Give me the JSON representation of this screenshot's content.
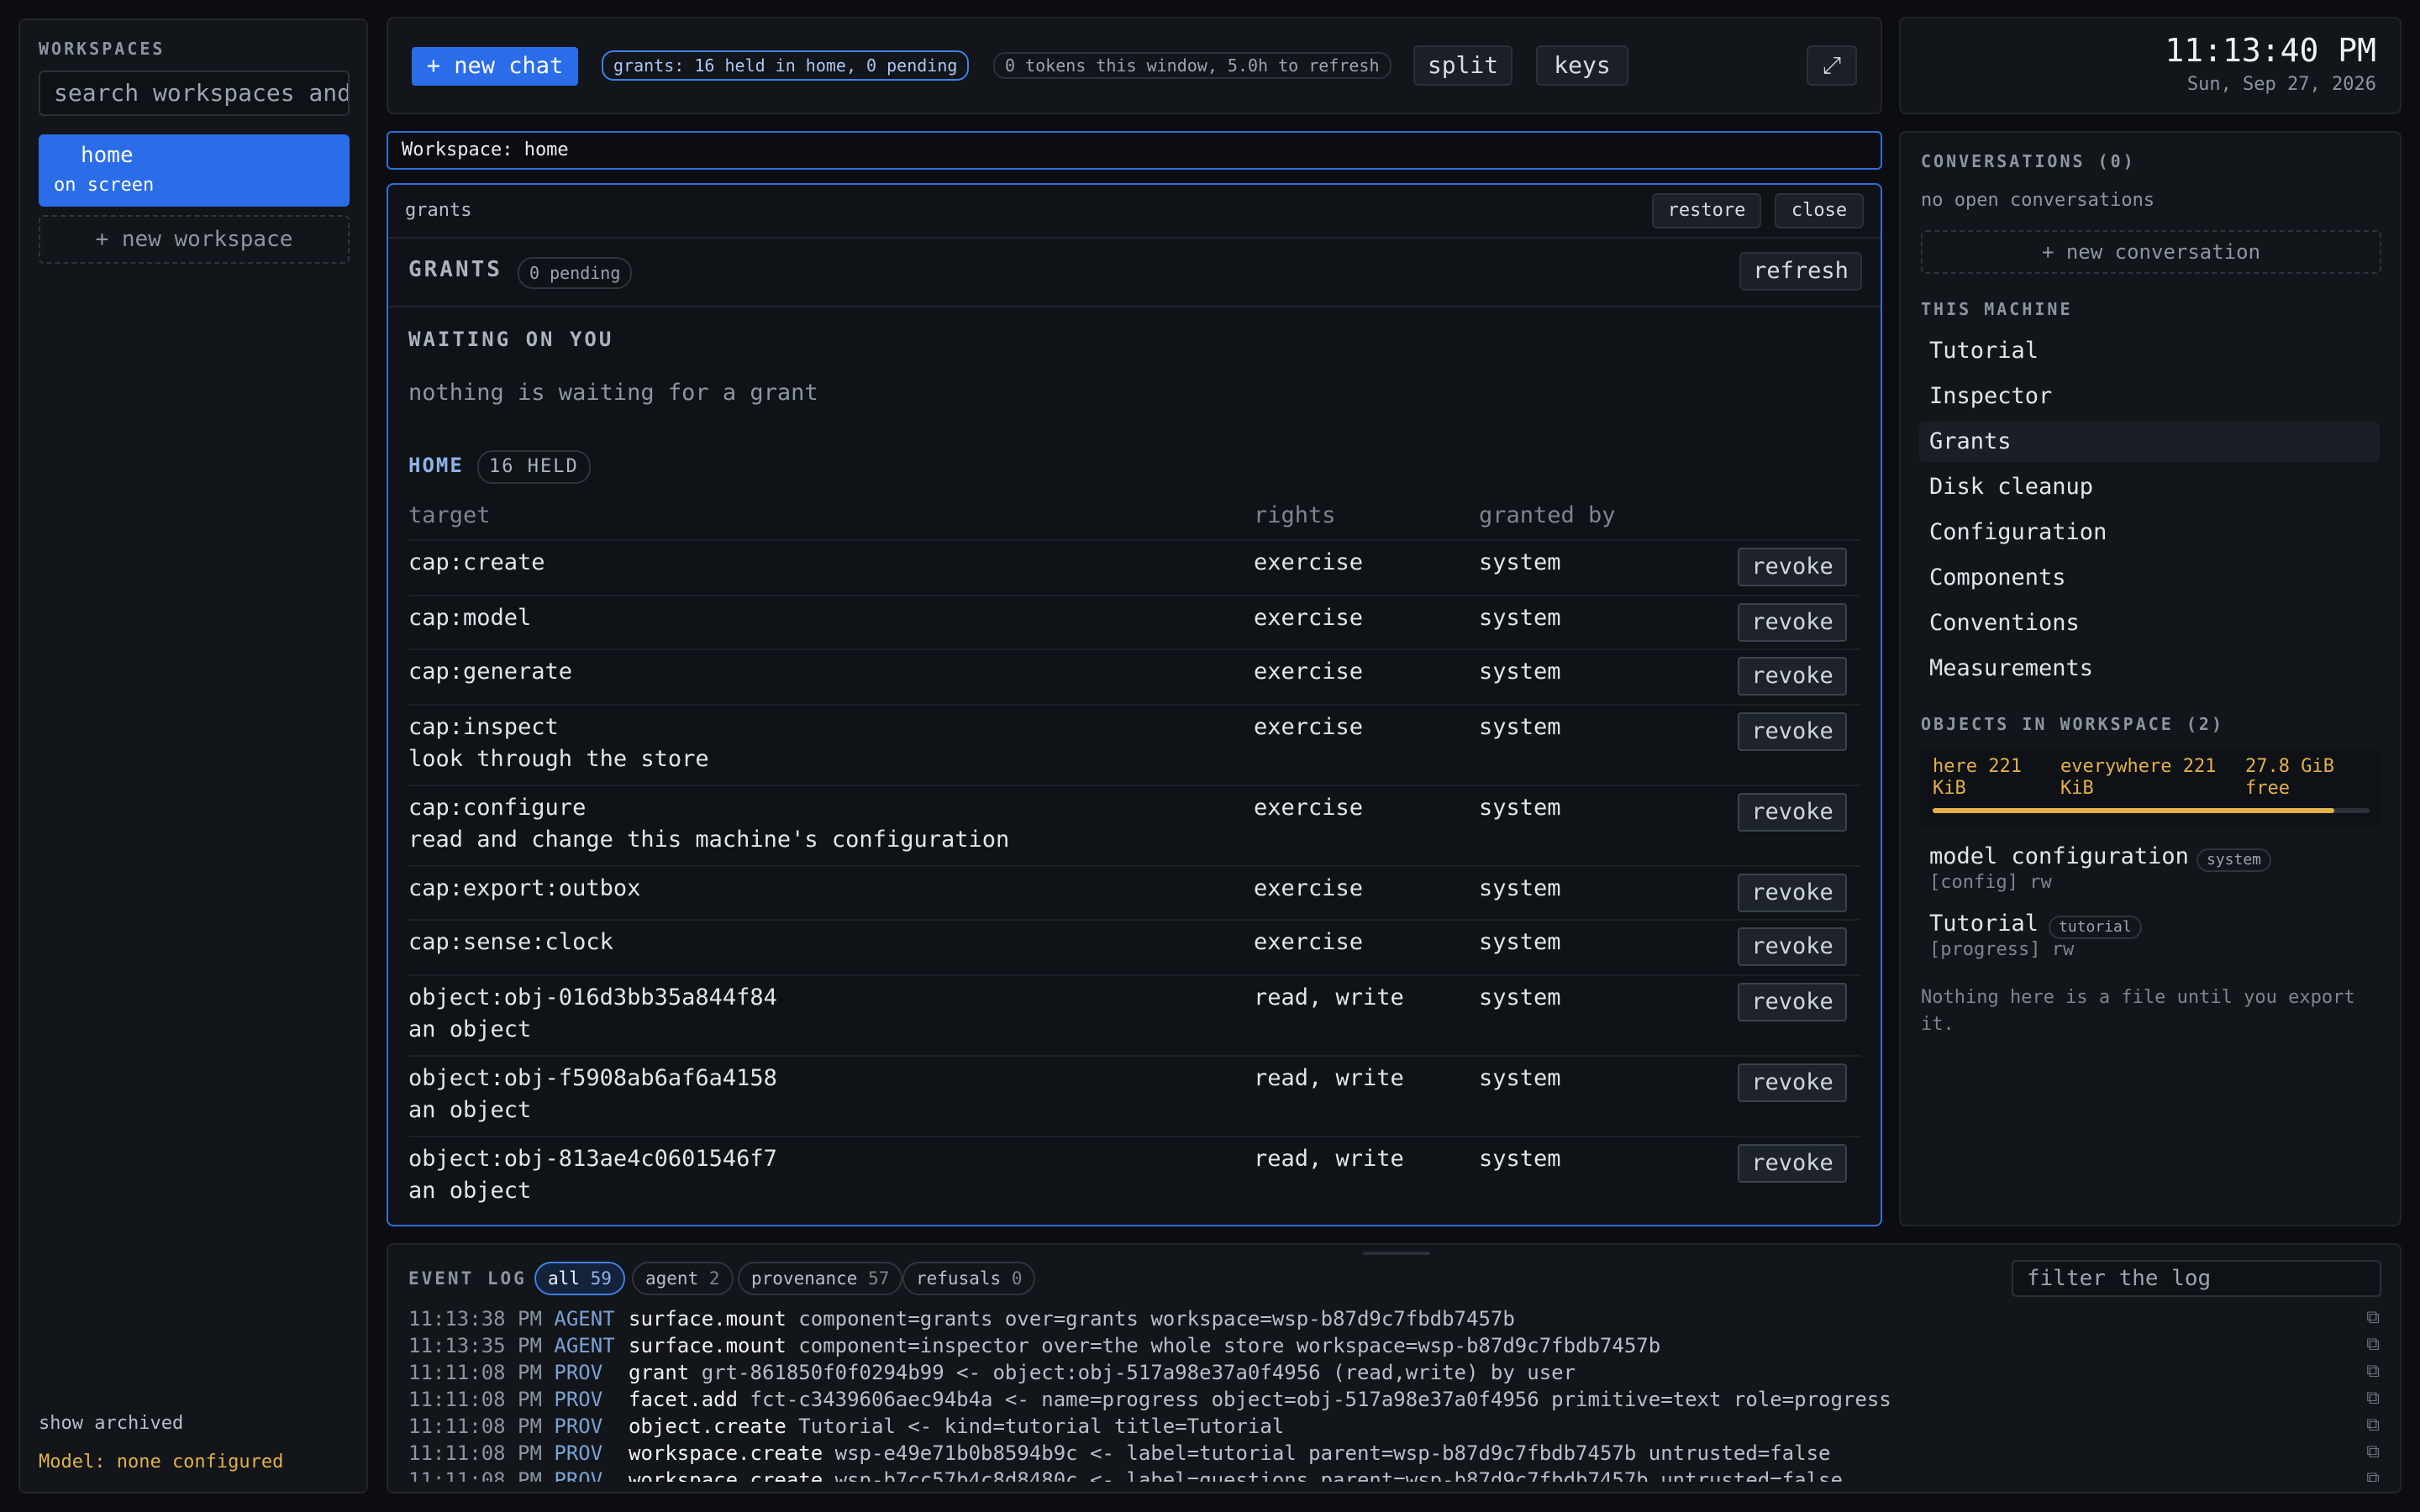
{
  "sidebar": {
    "title": "WORKSPACES",
    "search_placeholder": "search workspaces and",
    "workspaces": [
      {
        "label": "home",
        "status": "on screen"
      }
    ],
    "new_workspace": "+ new workspace",
    "show_archived": "show archived",
    "model_status": "Model: none configured"
  },
  "topbar": {
    "new_chat": "+ new chat",
    "grants_chip": "grants: 16 held in home, 0 pending",
    "tokens_chip": "0 tokens this window, 5.0h to refresh",
    "split": "split",
    "keys": "keys",
    "expand_icon": "expand-icon"
  },
  "clock": {
    "time": "11:13:40 PM",
    "date": "Sun, Sep 27, 2026"
  },
  "workspace_label": "Workspace: home",
  "grants_panel": {
    "tab_label": "grants",
    "restore": "restore",
    "close": "close",
    "title": "GRANTS",
    "pending_badge": "0 pending",
    "refresh": "refresh",
    "waiting_title": "WAITING ON YOU",
    "waiting_empty": "nothing is waiting for a grant",
    "home_title": "HOME",
    "held_badge": "16 HELD",
    "columns": [
      "target",
      "rights",
      "granted by"
    ],
    "revoke_label": "revoke",
    "rows": [
      {
        "target": "cap:create",
        "desc": "",
        "rights": "exercise",
        "by": "system"
      },
      {
        "target": "cap:model",
        "desc": "",
        "rights": "exercise",
        "by": "system"
      },
      {
        "target": "cap:generate",
        "desc": "",
        "rights": "exercise",
        "by": "system"
      },
      {
        "target": "cap:inspect",
        "desc": "look through the store",
        "rights": "exercise",
        "by": "system"
      },
      {
        "target": "cap:configure",
        "desc": "read and change this machine's configuration",
        "rights": "exercise",
        "by": "system"
      },
      {
        "target": "cap:export:outbox",
        "desc": "",
        "rights": "exercise",
        "by": "system"
      },
      {
        "target": "cap:sense:clock",
        "desc": "",
        "rights": "exercise",
        "by": "system"
      },
      {
        "target": "object:obj-016d3bb35a844f84",
        "desc": "an object",
        "rights": "read, write",
        "by": "system"
      },
      {
        "target": "object:obj-f5908ab6af6a4158",
        "desc": "an object",
        "rights": "read, write",
        "by": "system"
      },
      {
        "target": "object:obj-813ae4c0601546f7",
        "desc": "an object",
        "rights": "read, write",
        "by": "system"
      }
    ]
  },
  "right": {
    "conversations_title": "CONVERSATIONS (0)",
    "no_conversations": "no open conversations",
    "new_conversation": "+ new conversation",
    "machine_title": "THIS MACHINE",
    "machine_items": [
      "Tutorial",
      "Inspector",
      "Grants",
      "Disk cleanup",
      "Configuration",
      "Components",
      "Conventions",
      "Measurements"
    ],
    "active_item": "Grants",
    "objects_title": "OBJECTS IN WORKSPACE (2)",
    "storage": {
      "here": "here 221 KiB",
      "everywhere": "everywhere 221 KiB",
      "free": "27.8 GiB free",
      "used_fraction": 0.92
    },
    "objects": [
      {
        "name": "model configuration",
        "tag": "system",
        "meta": "[config] rw"
      },
      {
        "name": "Tutorial",
        "tag": "tutorial",
        "meta": "[progress] rw"
      }
    ],
    "footnote": "Nothing here is a file until you export it."
  },
  "log": {
    "title": "EVENT LOG",
    "filters": [
      {
        "label": "all",
        "count": "59"
      },
      {
        "label": "agent",
        "count": "2"
      },
      {
        "label": "provenance",
        "count": "57"
      },
      {
        "label": "refusals",
        "count": "0"
      }
    ],
    "filter_placeholder": "filter the log",
    "entries": [
      {
        "time": "11:13:38 PM",
        "actor": "AGENT",
        "event": "surface.mount",
        "args": "component=grants over=grants workspace=wsp-b87d9c7fbdb7457b"
      },
      {
        "time": "11:13:35 PM",
        "actor": "AGENT",
        "event": "surface.mount",
        "args": "component=inspector over=the whole store workspace=wsp-b87d9c7fbdb7457b"
      },
      {
        "time": "11:11:08 PM",
        "actor": "PROV",
        "event": "grant",
        "args": "grt-861850f0f0294b99 <- object:obj-517a98e37a0f4956 (read,write) by user"
      },
      {
        "time": "11:11:08 PM",
        "actor": "PROV",
        "event": "facet.add",
        "args": "fct-c3439606aec94b4a <- name=progress object=obj-517a98e37a0f4956 primitive=text role=progress"
      },
      {
        "time": "11:11:08 PM",
        "actor": "PROV",
        "event": "object.create",
        "args": "Tutorial <- kind=tutorial title=Tutorial"
      },
      {
        "time": "11:11:08 PM",
        "actor": "PROV",
        "event": "workspace.create",
        "args": "wsp-e49e71b0b8594b9c <- label=tutorial parent=wsp-b87d9c7fbdb7457b untrusted=false"
      },
      {
        "time": "11:11:08 PM",
        "actor": "PROV",
        "event": "workspace.create",
        "args": "wsp-b7cc57b4c8d8480c <- label=questions parent=wsp-b87d9c7fbdb7457b untrusted=false"
      }
    ]
  }
}
